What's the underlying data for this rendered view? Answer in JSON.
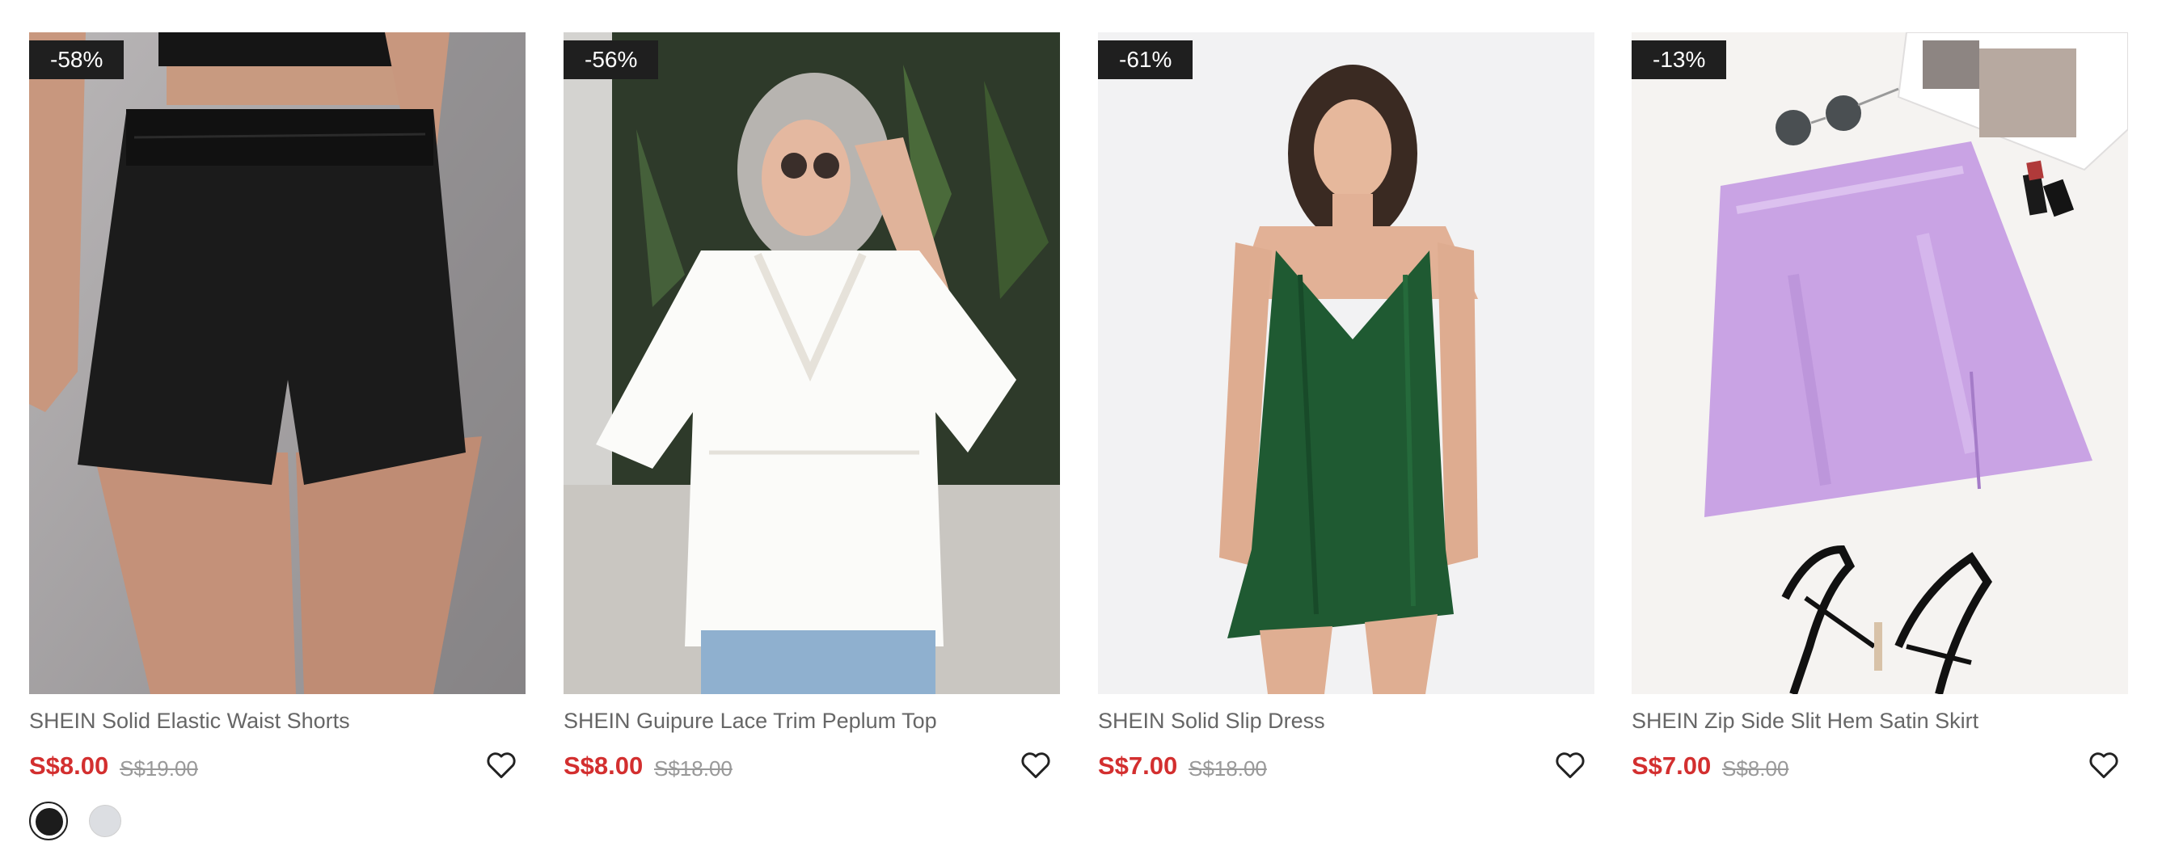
{
  "products": [
    {
      "discount": "-58%",
      "title": "SHEIN Solid Elastic Waist Shorts",
      "price": "S$8.00",
      "original_price": "S$19.00",
      "image": "black-shorts-photo",
      "swatches": [
        {
          "color": "#1c1c1c",
          "selected": true
        },
        {
          "color": "#dcdee2",
          "selected": false
        }
      ]
    },
    {
      "discount": "-56%",
      "title": "SHEIN Guipure Lace Trim Peplum Top",
      "price": "S$8.00",
      "original_price": "S$18.00",
      "image": "white-peplum-top-photo"
    },
    {
      "discount": "-61%",
      "title": "SHEIN Solid Slip Dress",
      "price": "S$7.00",
      "original_price": "S$18.00",
      "image": "green-slip-dress-photo"
    },
    {
      "discount": "-13%",
      "title": "SHEIN Zip Side Slit Hem Satin Skirt",
      "price": "S$7.00",
      "original_price": "S$8.00",
      "image": "lilac-satin-skirt-photo"
    }
  ],
  "colors": {
    "sale_price": "#d32f2f",
    "badge_bg": "#1f1f1f",
    "original_price": "#999999"
  }
}
